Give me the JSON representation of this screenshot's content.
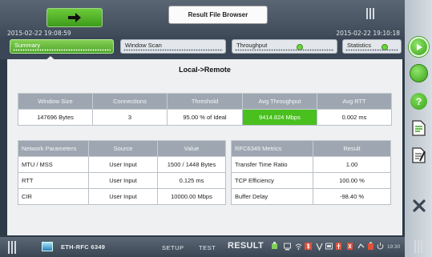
{
  "header": {
    "title": "Result File Browser",
    "timestamp_left": "2015-02-22 19:08:59",
    "timestamp_right": "2015-02-22 19:10:18"
  },
  "tabs": [
    {
      "label": "Summary",
      "active": true
    },
    {
      "label": "Window Scan",
      "active": false
    },
    {
      "label": "Throughput",
      "active": false,
      "led": "green"
    },
    {
      "label": "Statistics",
      "active": false,
      "led": "green"
    }
  ],
  "main": {
    "direction_title": "Local->Remote",
    "summary": {
      "headers": [
        "Window Size",
        "Connections",
        "Threshold",
        "Avg Throughput",
        "Avg RTT"
      ],
      "row": [
        "147696 Bytes",
        "3",
        "95.00 % of Ideal",
        "9414.824 Mbps",
        "0.002 ms"
      ]
    },
    "network": {
      "headers": [
        "Network Parameters",
        "Source",
        "Value"
      ],
      "rows": [
        [
          "MTU / MSS",
          "User Input",
          "1500 / 1448 Bytes"
        ],
        [
          "RTT",
          "User Input",
          "0.125 ms"
        ],
        [
          "CIR",
          "User Input",
          "10000.00 Mbps"
        ]
      ]
    },
    "rfc": {
      "headers": [
        "RFC6349 Metrics",
        "Result"
      ],
      "rows": [
        [
          "Transfer Time Ratio",
          "1.00"
        ],
        [
          "TCP Efficiency",
          "100.00 %"
        ],
        [
          "Buffer Delay",
          "-98.40 %"
        ]
      ]
    }
  },
  "bottombar": {
    "app_name": "ETH-RFC 6349",
    "nav_setup": "SETUP",
    "nav_test": "TEST",
    "nav_result": "RESULT",
    "clock": "19:30"
  },
  "colors": {
    "accent_green": "#49c01e",
    "header_bg": "#3e4a58",
    "table_header": "#9ea7b1"
  },
  "icons": {
    "header_button": "arrow-right-icon",
    "sidebar": [
      "start-test-icon",
      "status-led-icon",
      "help-icon",
      "report-icon",
      "edit-report-icon",
      "close-icon"
    ]
  }
}
